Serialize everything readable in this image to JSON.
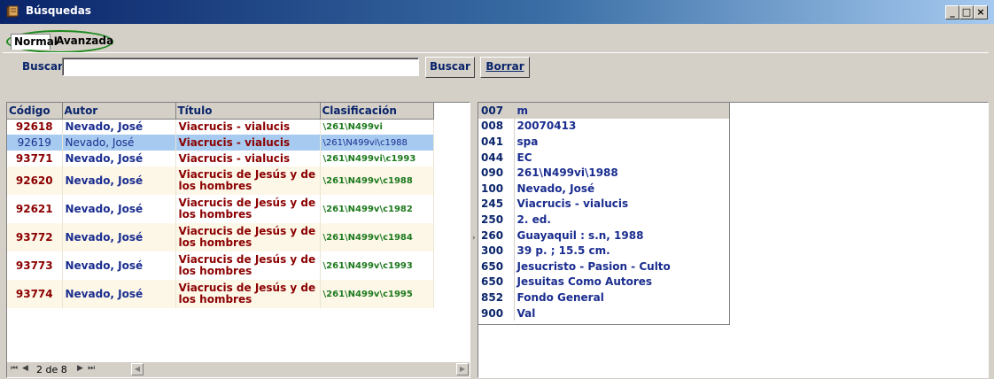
{
  "window": {
    "title": "Búsquedas",
    "controls": {
      "minimize": "_",
      "maximize": "□",
      "close": "×"
    }
  },
  "tabs": [
    {
      "label": "Normal",
      "active": true
    },
    {
      "label": "Avanzada",
      "active": false
    }
  ],
  "search": {
    "label": "Buscar",
    "value": "",
    "buscar_button": "Buscar",
    "borrar_button": "Borrar"
  },
  "results": {
    "columns": [
      "Código",
      "Autor",
      "Título",
      "Clasificación"
    ],
    "rows": [
      {
        "codigo": "92618",
        "autor": "Nevado, José",
        "titulo": "Viacrucis - vialucis",
        "clasificacion": "\\261\\N499vi"
      },
      {
        "codigo": "92619",
        "autor": "Nevado, José",
        "titulo": "Viacrucis - vialucis",
        "clasificacion": "\\261\\N499vi\\c1988",
        "selected": true
      },
      {
        "codigo": "93771",
        "autor": "Nevado, José",
        "titulo": "Viacrucis - vialucis",
        "clasificacion": "\\261\\N499vi\\c1993"
      },
      {
        "codigo": "92620",
        "autor": "Nevado, José",
        "titulo": "Viacrucis de Jesús y de los hombres",
        "clasificacion": "\\261\\N499v\\c1988"
      },
      {
        "codigo": "92621",
        "autor": "Nevado, José",
        "titulo": "Viacrucis de Jesús y de los hombres",
        "clasificacion": "\\261\\N499v\\c1982"
      },
      {
        "codigo": "93772",
        "autor": "Nevado, José",
        "titulo": "Viacrucis de Jesús y de los hombres",
        "clasificacion": "\\261\\N499v\\c1984"
      },
      {
        "codigo": "93773",
        "autor": "Nevado, José",
        "titulo": "Viacrucis de Jesús y de los hombres",
        "clasificacion": "\\261\\N499v\\c1993"
      },
      {
        "codigo": "93774",
        "autor": "Nevado, José",
        "titulo": "Viacrucis de Jesús y de los hombres",
        "clasificacion": "\\261\\N499v\\c1995"
      }
    ]
  },
  "pager": {
    "first_icon": "first-page-icon",
    "prev_icon": "prev-page-icon",
    "text": "2 de 8",
    "next_icon": "next-page-icon",
    "last_icon": "last-page-icon"
  },
  "marc": [
    {
      "tag": "007",
      "value": "m"
    },
    {
      "tag": "008",
      "value": "20070413"
    },
    {
      "tag": "041",
      "value": "spa"
    },
    {
      "tag": "044",
      "value": "EC"
    },
    {
      "tag": "090",
      "value": "261\\N499vi\\1988"
    },
    {
      "tag": "100",
      "value": "Nevado, José"
    },
    {
      "tag": "245",
      "value": "Viacrucis - vialucis"
    },
    {
      "tag": "250",
      "value": "2. ed."
    },
    {
      "tag": "260",
      "value": "Guayaquil : s.n, 1988"
    },
    {
      "tag": "300",
      "value": "39 p. ; 15.5 cm."
    },
    {
      "tag": "650",
      "value": "Jesucristo - Pasion - Culto"
    },
    {
      "tag": "650",
      "value": "Jesuitas Como Autores"
    },
    {
      "tag": "852",
      "value": "Fondo General"
    },
    {
      "tag": "900",
      "value": "Val"
    }
  ],
  "colors": {
    "titlebar_start": "#0a246a",
    "titlebar_end": "#a6caf0",
    "code_color": "#8b0000",
    "author_color": "#1a2d8f",
    "classification_color": "#1e7a1e",
    "selection": "#a6caf0",
    "tab_highlight": "#1c8a1c"
  }
}
